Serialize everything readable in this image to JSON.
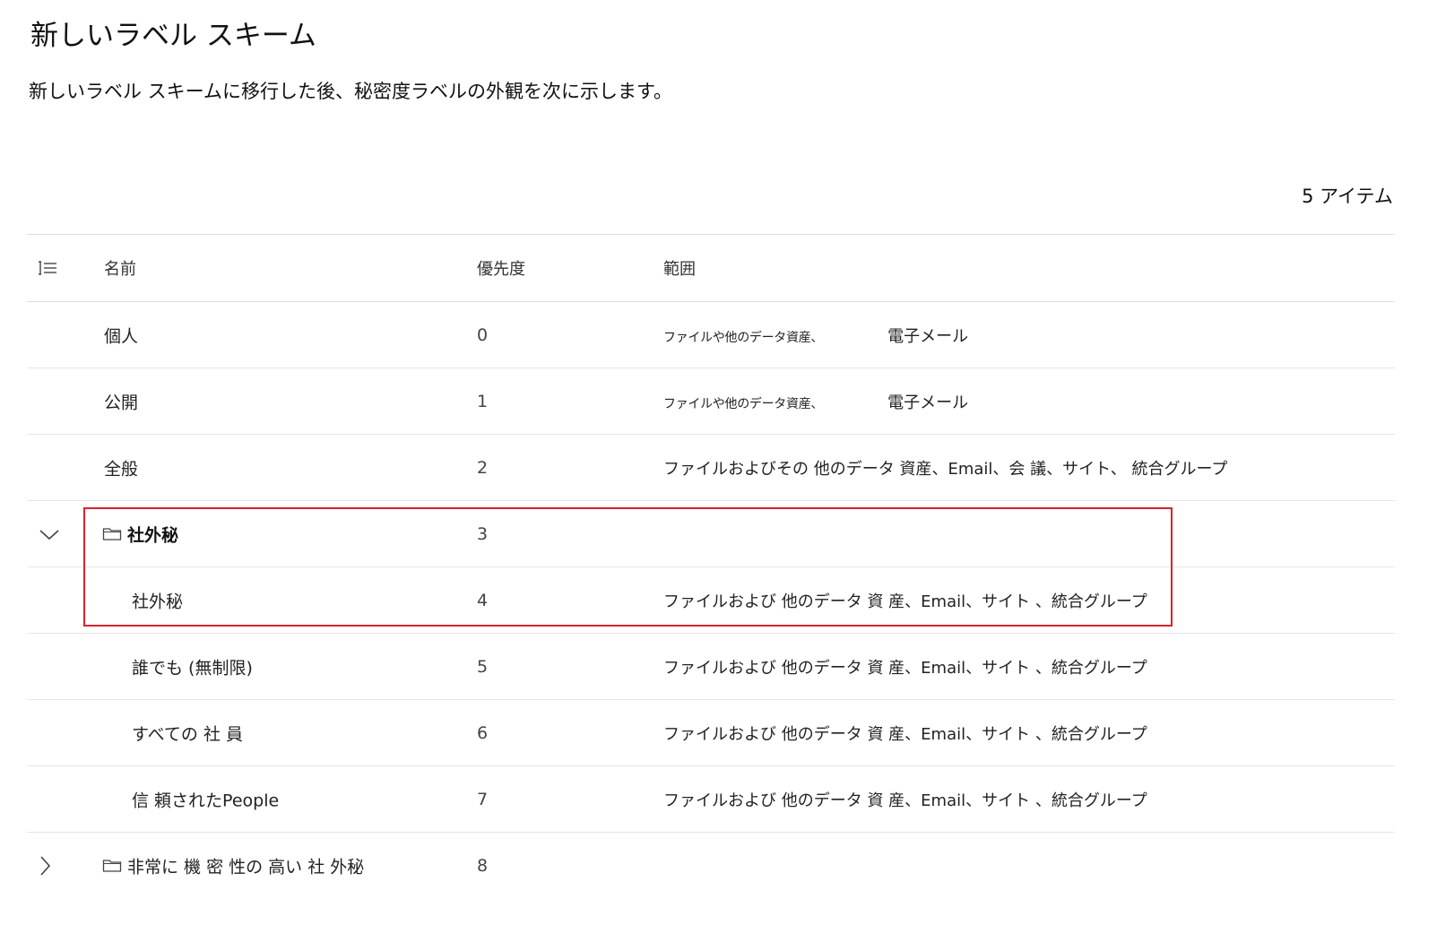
{
  "page": {
    "title": "新しいラベル スキーム",
    "description": "新しいラベル スキームに移行した後、秘密度ラベルの外観を次に示します。",
    "item_count": "5 アイテム"
  },
  "table": {
    "headers": {
      "name": "名前",
      "priority": "優先度",
      "scope": "範囲"
    },
    "rows": [
      {
        "name": "個人",
        "priority": "0",
        "scope_a": "ファイルや他のデータ資産、",
        "scope_b": "電子メール"
      },
      {
        "name": "公開",
        "priority": "1",
        "scope_a": "ファイルや他のデータ資産、",
        "scope_b": "電子メール"
      },
      {
        "name": "全般",
        "priority": "2",
        "scope": "ファイルおよびその 他のデータ 資産、Email、会 議、サイト、 統合グループ"
      },
      {
        "name": "社外秘",
        "priority": "3",
        "scope": "",
        "type": "group",
        "expanded": true
      },
      {
        "name": "社外秘",
        "priority": "4",
        "scope": "ファイルおよび 他のデータ 資 産、Email、サイト 、統合グループ"
      },
      {
        "name": "誰でも (無制限)",
        "priority": "5",
        "scope": "ファイルおよび 他のデータ 資 産、Email、サイト 、統合グループ"
      },
      {
        "name": "すべての 社 員",
        "priority": "6",
        "scope": "ファイルおよび 他のデータ 資 産、Email、サイト 、統合グループ"
      },
      {
        "name": "信 頼されたPeople",
        "priority": "7",
        "scope": "ファイルおよび 他のデータ 資 産、Email、サイト 、統合グループ"
      },
      {
        "name": "非常に 機 密 性の 高い 社 外秘",
        "priority": "8",
        "scope": "",
        "type": "group",
        "expanded": false
      }
    ]
  },
  "highlight": {
    "color": "#d6232f"
  }
}
